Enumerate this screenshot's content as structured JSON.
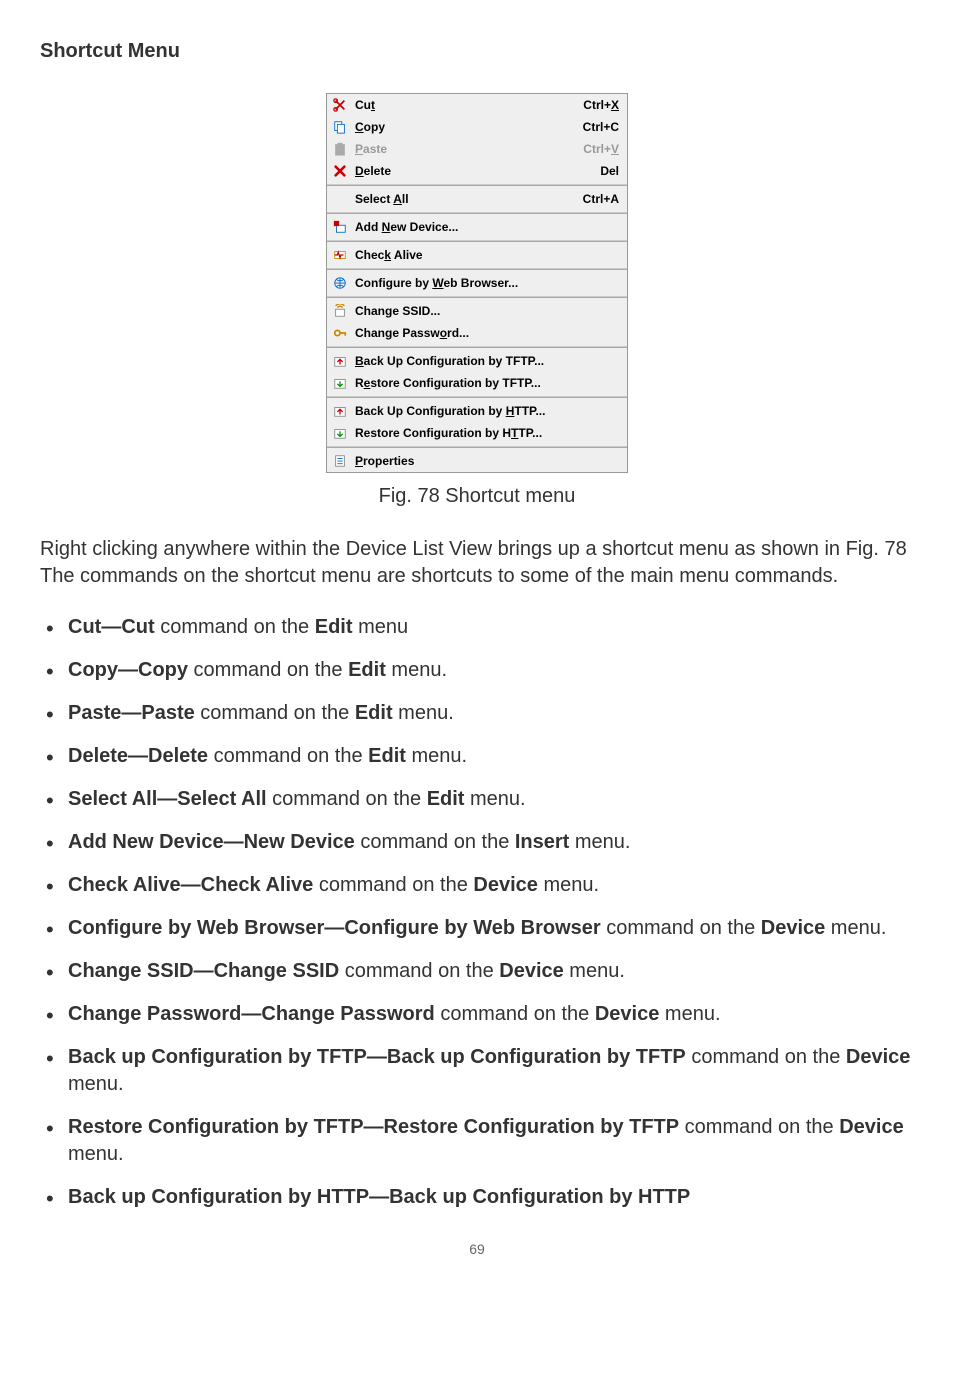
{
  "page": {
    "title": "Shortcut Menu",
    "figure_caption": "Fig. 78 Shortcut menu",
    "intro_text": "Right clicking anywhere within the Device List View brings up a shortcut menu as shown in Fig. 78 The commands on the shortcut menu are shortcuts to some of the main menu commands.",
    "page_number": "69"
  },
  "menu": {
    "groups": [
      [
        {
          "icon": "scissors",
          "label_pre": "Cu",
          "mnemonic": "t",
          "label_post": "",
          "shortcut_pre": "Ctrl+",
          "shortcut_mn": "X",
          "disabled": false
        },
        {
          "icon": "copy",
          "label_pre": "",
          "mnemonic": "C",
          "label_post": "opy",
          "shortcut_pre": "Ctrl+C",
          "shortcut_mn": "",
          "disabled": false
        },
        {
          "icon": "paste",
          "label_pre": "",
          "mnemonic": "P",
          "label_post": "aste",
          "shortcut_pre": "Ctrl+",
          "shortcut_mn": "V",
          "disabled": true
        },
        {
          "icon": "delete",
          "label_pre": "",
          "mnemonic": "D",
          "label_post": "elete",
          "shortcut_pre": "Del",
          "shortcut_mn": "",
          "disabled": false
        }
      ],
      [
        {
          "icon": "",
          "label_pre": "Select ",
          "mnemonic": "A",
          "label_post": "ll",
          "shortcut_pre": "Ctrl+A",
          "shortcut_mn": "",
          "disabled": false
        }
      ],
      [
        {
          "icon": "add-device",
          "label_pre": "Add ",
          "mnemonic": "N",
          "label_post": "ew Device...",
          "shortcut_pre": "",
          "shortcut_mn": "",
          "disabled": false
        }
      ],
      [
        {
          "icon": "check-alive",
          "label_pre": "Chec",
          "mnemonic": "k",
          "label_post": " Alive",
          "shortcut_pre": "",
          "shortcut_mn": "",
          "disabled": false
        }
      ],
      [
        {
          "icon": "web",
          "label_pre": "Configure by ",
          "mnemonic": "W",
          "label_post": "eb Browser...",
          "shortcut_pre": "",
          "shortcut_mn": "",
          "disabled": false
        }
      ],
      [
        {
          "icon": "ssid",
          "label_pre": "Change SSID...",
          "mnemonic": "",
          "label_post": "",
          "shortcut_pre": "",
          "shortcut_mn": "",
          "disabled": false
        },
        {
          "icon": "password",
          "label_pre": "Change Passw",
          "mnemonic": "o",
          "label_post": "rd...",
          "shortcut_pre": "",
          "shortcut_mn": "",
          "disabled": false
        }
      ],
      [
        {
          "icon": "backup",
          "label_pre": "",
          "mnemonic": "B",
          "label_post": "ack Up Configuration by TFTP...",
          "shortcut_pre": "",
          "shortcut_mn": "",
          "disabled": false
        },
        {
          "icon": "restore",
          "label_pre": "R",
          "mnemonic": "e",
          "label_post": "store Configuration by TFTP...",
          "shortcut_pre": "",
          "shortcut_mn": "",
          "disabled": false
        }
      ],
      [
        {
          "icon": "backup",
          "label_pre": "Back Up Configuration by ",
          "mnemonic": "H",
          "label_post": "TTP...",
          "shortcut_pre": "",
          "shortcut_mn": "",
          "disabled": false
        },
        {
          "icon": "restore",
          "label_pre": "Restore Configuration by H",
          "mnemonic": "T",
          "label_post": "TP...",
          "shortcut_pre": "",
          "shortcut_mn": "",
          "disabled": false
        }
      ],
      [
        {
          "icon": "properties",
          "label_pre": "",
          "mnemonic": "P",
          "label_post": "roperties",
          "shortcut_pre": "",
          "shortcut_mn": "",
          "disabled": false
        }
      ]
    ]
  },
  "list_items": [
    {
      "bold1": "Cut—Cut",
      "mid": " command on the ",
      "bold2": "Edit",
      "tail": " menu"
    },
    {
      "bold1": "Copy—Copy",
      "mid": " command on the ",
      "bold2": "Edit",
      "tail": " menu."
    },
    {
      "bold1": "Paste—Paste",
      "mid": " command on the ",
      "bold2": "Edit",
      "tail": " menu."
    },
    {
      "bold1": "Delete—Delete",
      "mid": " command on the ",
      "bold2": "Edit",
      "tail": " menu."
    },
    {
      "bold1": "Select All—Select All",
      "mid": " command on the ",
      "bold2": "Edit",
      "tail": " menu."
    },
    {
      "bold1": "Add New Device—New Device",
      "mid": " command on the ",
      "bold2": "Insert",
      "tail": " menu."
    },
    {
      "bold1": "Check Alive—Check Alive",
      "mid": " command on the ",
      "bold2": "Device",
      "tail": " menu."
    },
    {
      "bold1": "Configure by Web Browser—Configure by Web Browser",
      "mid": " command on the ",
      "bold2": "Device",
      "tail": " menu."
    },
    {
      "bold1": "Change SSID—Change SSID",
      "mid": " command on the ",
      "bold2": "Device",
      "tail": " menu."
    },
    {
      "bold1": "Change Password—Change Password",
      "mid": " command on the ",
      "bold2": "Device",
      "tail": " menu."
    },
    {
      "bold1": "Back up Configuration by TFTP—Back up Configuration by TFTP",
      "mid": " command on the ",
      "bold2": "Device",
      "tail": " menu."
    },
    {
      "bold1": "Restore Configuration by TFTP—Restore Configuration by TFTP",
      "mid": " command on the ",
      "bold2": "Device",
      "tail": " menu."
    },
    {
      "bold1": "Back up Configuration by HTTP—Back up Configuration by HTTP",
      "mid": "",
      "bold2": "",
      "tail": ""
    }
  ]
}
